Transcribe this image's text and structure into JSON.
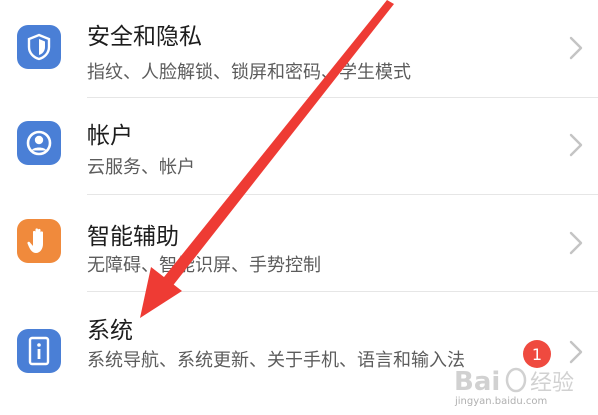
{
  "settings": {
    "items": [
      {
        "icon": "shield-icon",
        "icon_color": "#4a7fd6",
        "title": "安全和隐私",
        "subtitle": "指纹、人脸解锁、锁屏和密码、学生模式"
      },
      {
        "icon": "account-icon",
        "icon_color": "#4a7fd6",
        "title": "帐户",
        "subtitle": "云服务、帐户"
      },
      {
        "icon": "hand-icon",
        "icon_color": "#f08a3c",
        "title": "智能辅助",
        "subtitle": "无障碍、智能识屏、手势控制"
      },
      {
        "icon": "system-icon",
        "icon_color": "#4a7fd6",
        "title": "系统",
        "subtitle": "系统导航、系统更新、关于手机、语言和输入法",
        "badge": "1"
      }
    ]
  },
  "overlay": {
    "annotation": "red-arrow-pointing-to-system",
    "arrow_color": "#ee3b34",
    "watermark_logo": "Bai 经验",
    "watermark_url": "jingyan.baidu.com"
  }
}
